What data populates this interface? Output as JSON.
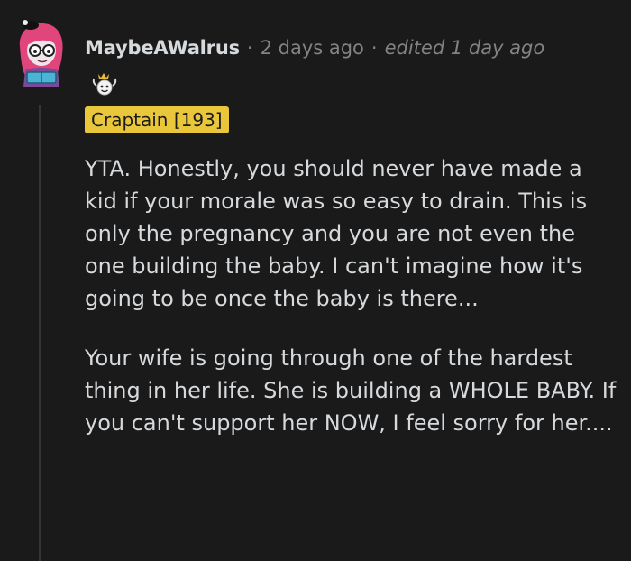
{
  "comment": {
    "author": "MaybeAWalrus",
    "separator": "·",
    "timestamp": "2 days ago",
    "edited": "edited 1 day ago",
    "award_icon": "wholesome-award-icon",
    "flair": "Craptain [193]",
    "paragraphs": [
      "YTA. Honestly, you should never have made a kid if your morale was so easy to drain. This is only the pregnancy and you are not even the one building the baby. I can't imagine how it's going to be once the baby is there...",
      "Your wife is going through one of the hardest thing in her life. She is building a WHOLE BABY. If you can't support her NOW, I feel sorry for her...."
    ]
  },
  "colors": {
    "background": "#1a1a1b",
    "text": "#d7dadc",
    "meta": "#818384",
    "flair_background": "#eac73a",
    "avatar_hair": "#e0457b"
  }
}
